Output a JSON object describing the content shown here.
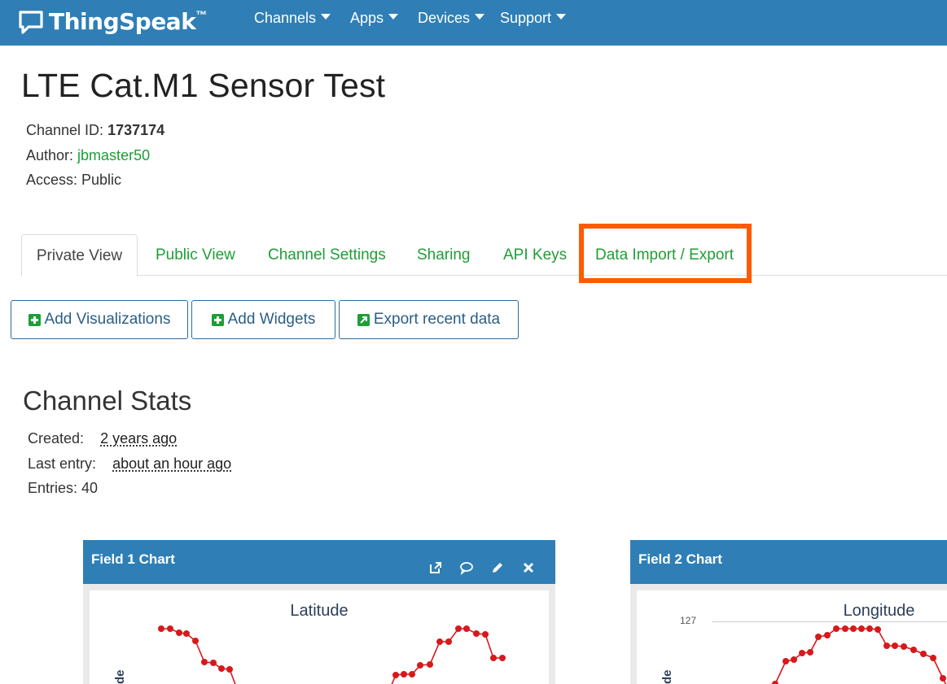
{
  "nav": {
    "brand": "ThingSpeak",
    "brand_tm": "™",
    "items": [
      {
        "label": "Channels"
      },
      {
        "label": "Apps"
      },
      {
        "label": "Devices"
      },
      {
        "label": "Support"
      }
    ]
  },
  "channel": {
    "title": "LTE Cat.M1 Sensor Test",
    "id_label": "Channel ID: ",
    "id_value": "1737174",
    "author_label": "Author: ",
    "author_value": "jbmaster50",
    "access_label": "Access: ",
    "access_value": "Public"
  },
  "tabs": [
    {
      "label": "Private View",
      "active": true
    },
    {
      "label": "Public View"
    },
    {
      "label": "Channel Settings"
    },
    {
      "label": "Sharing"
    },
    {
      "label": "API Keys"
    },
    {
      "label": "Data Import / Export",
      "highlighted": true
    }
  ],
  "buttons": {
    "add_visualizations": "Add Visualizations",
    "add_widgets": "Add Widgets",
    "export_recent": "Export recent data"
  },
  "stats": {
    "title": "Channel Stats",
    "created_label": "Created:",
    "created_value": "2 years ago",
    "last_entry_label": "Last entry:",
    "last_entry_value": "about an hour ago",
    "entries": "Entries: 40"
  },
  "charts": [
    {
      "panel_title": "Field 1 Chart",
      "chart_title": "Latitude",
      "ylabel_visible": "de"
    },
    {
      "panel_title": "Field 2 Chart",
      "chart_title": "Longitude",
      "ylabel_visible": "de",
      "tick_label": "127"
    }
  ],
  "colors": {
    "navbar": "#2f7fb6",
    "link": "#1e9e36",
    "highlight": "#ff5a00",
    "series": "#d7191c"
  }
}
